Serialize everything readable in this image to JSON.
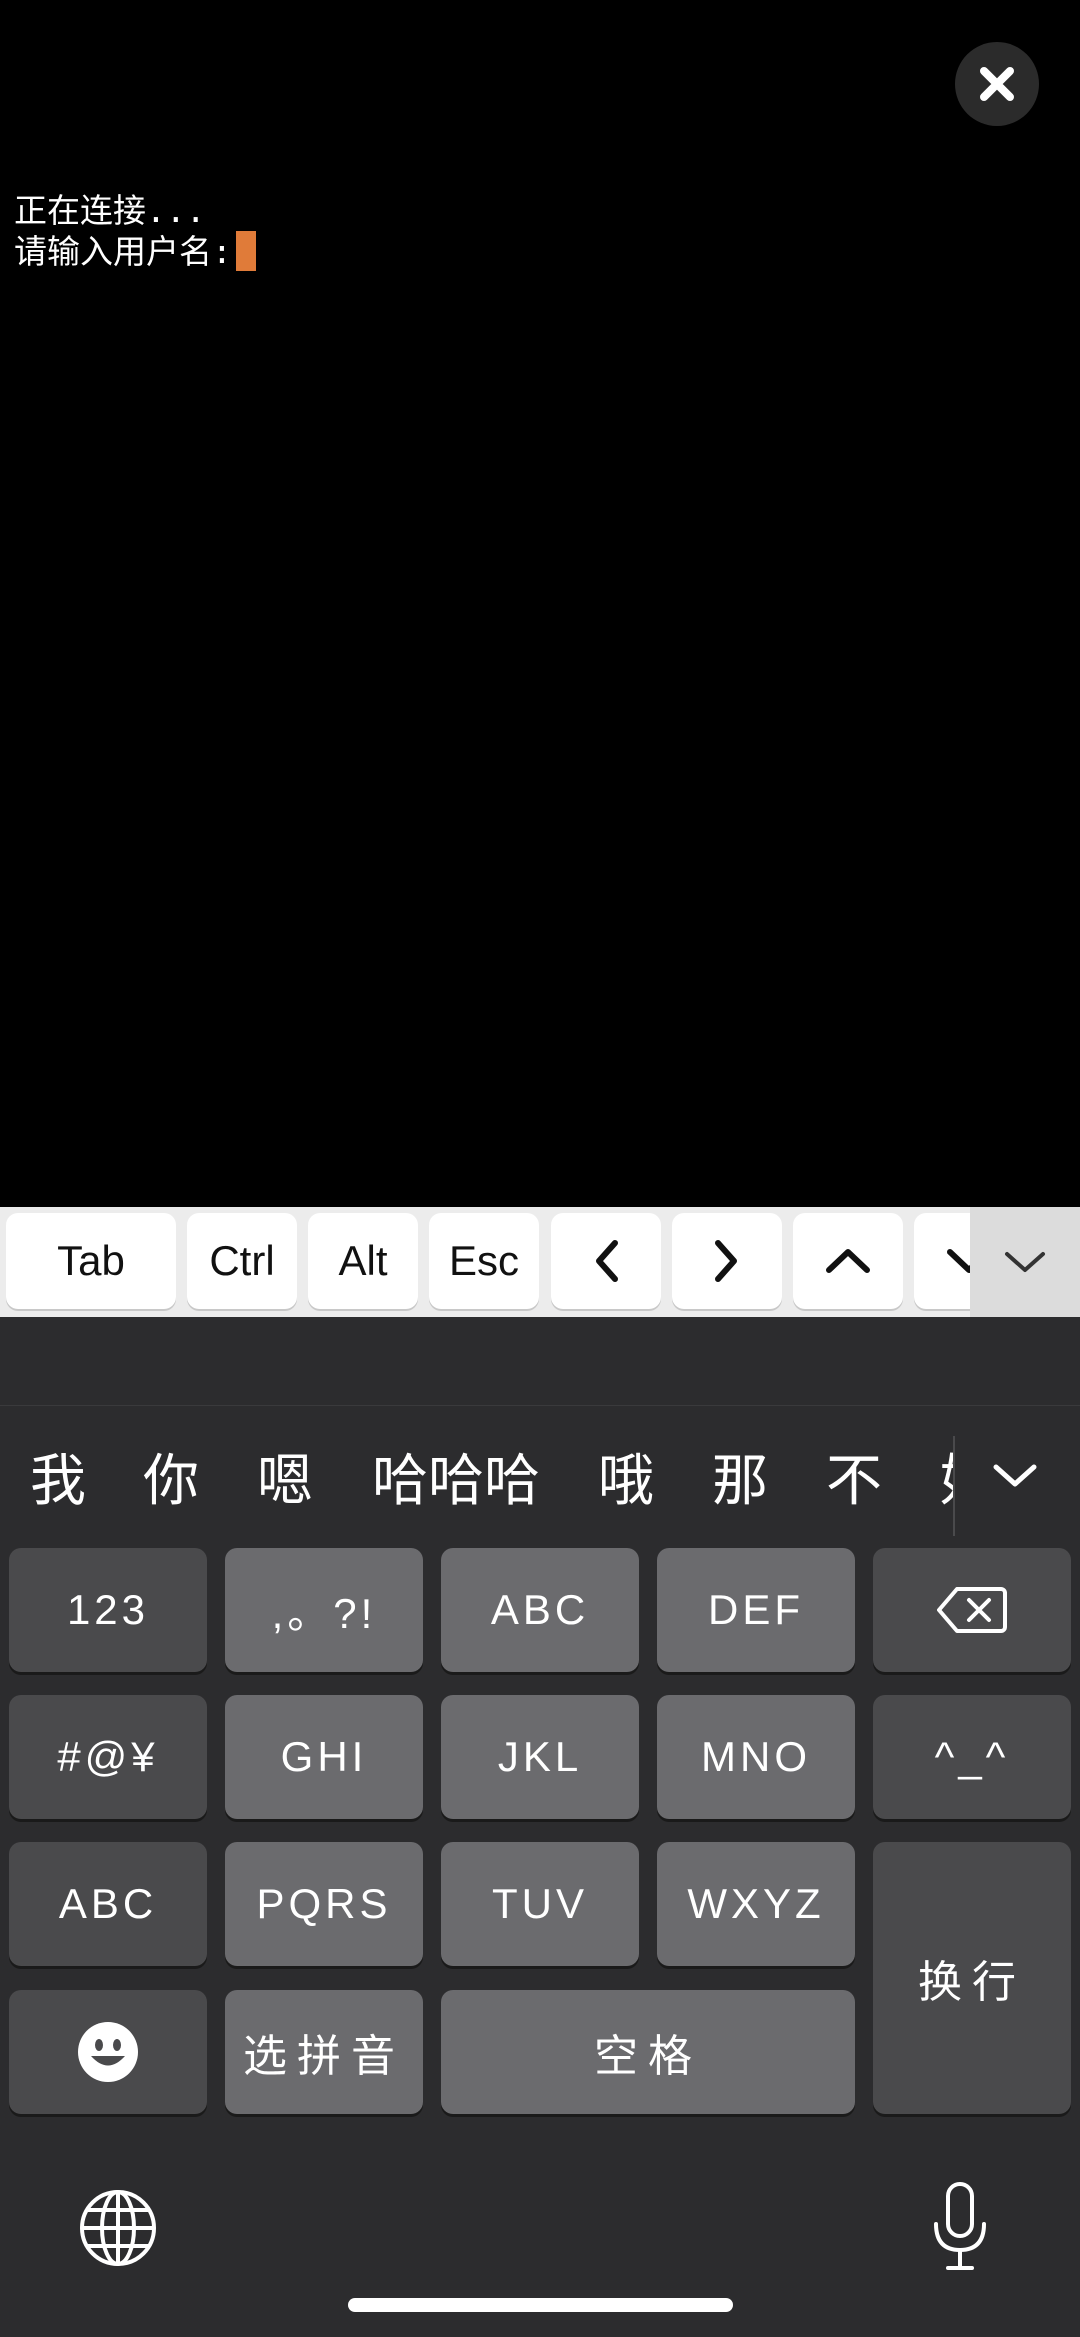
{
  "terminal": {
    "lines": [
      "正在连接...",
      "请输入用户名:"
    ],
    "cursor_color": "#e07b39"
  },
  "accessory_bar": {
    "keys": [
      "Tab",
      "Ctrl",
      "Alt",
      "Esc"
    ],
    "arrow_icons": [
      "chevron-left-icon",
      "chevron-right-icon",
      "chevron-up-icon",
      "chevron-down-icon"
    ],
    "collapse_icon": "chevron-down-icon"
  },
  "candidates": [
    "我",
    "你",
    "嗯",
    "哈哈哈",
    "哦",
    "那",
    "不",
    "好"
  ],
  "keyboard": {
    "row1": [
      "123",
      ",。?!",
      "ABC",
      "DEF"
    ],
    "row2": [
      "#@¥",
      "GHI",
      "JKL",
      "MNO",
      "^_^"
    ],
    "row3": [
      "ABC",
      "PQRS",
      "TUV",
      "WXYZ"
    ],
    "row4": [
      "选拼音",
      "空格"
    ],
    "return_label": "换行",
    "delete_icon": "backspace-icon",
    "emoji_icon": "emoji-icon",
    "globe_icon": "globe-icon",
    "mic_icon": "microphone-icon"
  }
}
